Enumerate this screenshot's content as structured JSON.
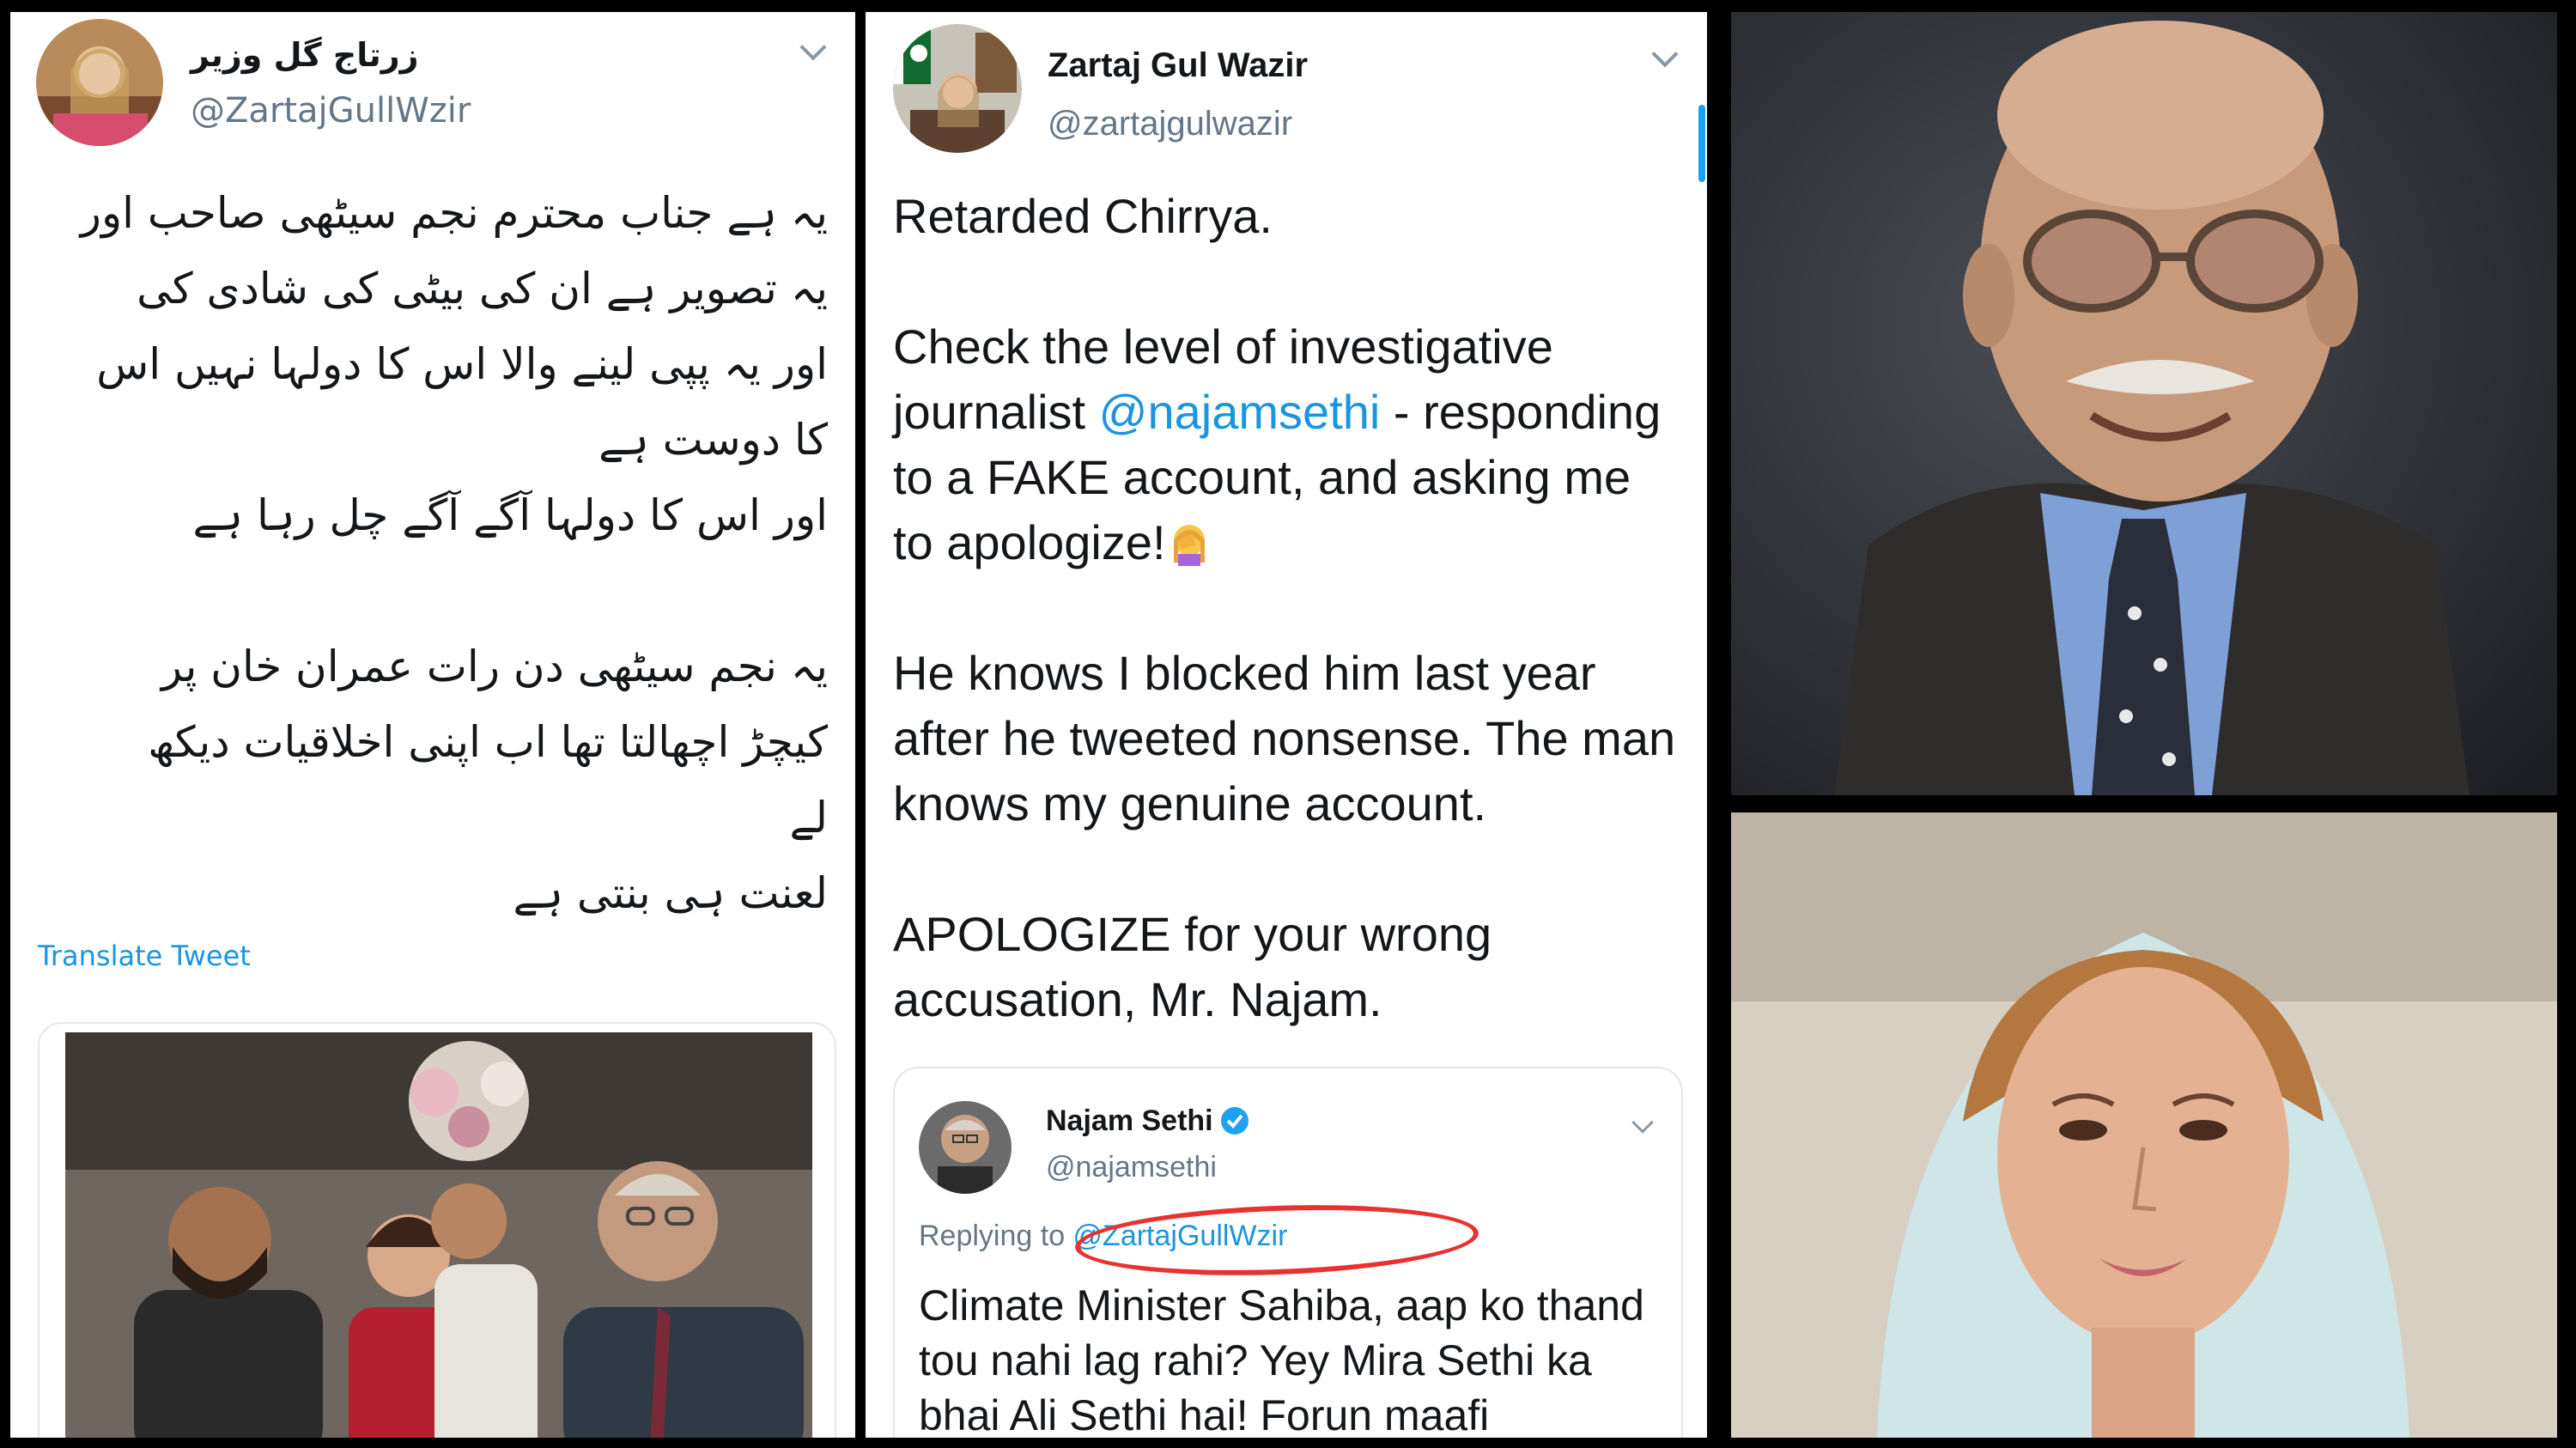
{
  "tweet_urdu": {
    "display_name": "زرتاج گل وزیر",
    "handle": "@ZartajGullWzir",
    "lines": [
      "یہ ہے جناب محترم نجم سیٹھی صاحب اور",
      "یہ تصویر ہے ان کی بیٹی کی شادی کی",
      "اور یہ پپی لینے والا اس کا دولہا نہیں اس",
      "کا دوست ہے",
      "اور اس کا دولہا آگے آگے چل رہا ہے",
      "",
      "یہ نجم سیٹھی دن رات عمران خان پر",
      "کیچڑ اچھالتا تھا اب اپنی اخلاقیات دیکھ",
      "لے",
      "لعنت ہی بنتی ہے"
    ],
    "translate_label": "Translate Tweet"
  },
  "tweet_english": {
    "display_name": "Zartaj Gul Wazir",
    "handle": "@zartajgulwazir",
    "para1": "Retarded Chirrya.",
    "para2_before": "Check the level of investigative journalist ",
    "para2_mention": "@najamsethi",
    "para2_after": " - responding to a FAKE account, and asking me to apologize!",
    "para3": "He knows I blocked him last year after he tweeted nonsense. The man knows my genuine account.",
    "para4": "APOLOGIZE for your wrong accusation, Mr. Najam.",
    "emoji": "woman-facepalming-emoji"
  },
  "quoted_tweet": {
    "display_name": "Najam Sethi",
    "handle": "@najamsethi",
    "replying_prefix": "Replying to ",
    "replying_mention": "@ZartajGullWzir",
    "text": "Climate Minister Sahiba, aap ko thand tou nahi lag rahi? Yey Mira Sethi ka bhai Ali Sethi hai! Forun maafi",
    "verified_icon": "verified-badge-icon"
  },
  "colors": {
    "link_blue": "#1b95e0",
    "muted_gray": "#657786",
    "annotation_red": "#e8322f",
    "border": "#e1e8ed"
  }
}
